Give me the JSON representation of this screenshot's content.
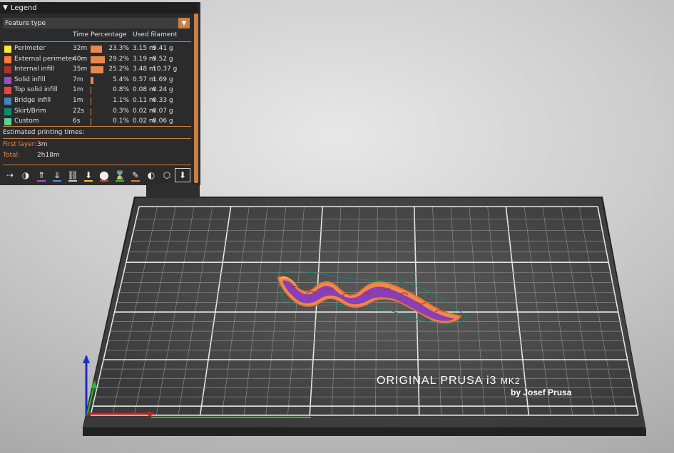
{
  "legend": {
    "title": "Legend",
    "view_type": "Feature type",
    "columns": {
      "time": "Time",
      "percentage": "Percentage",
      "used_filament": "Used filament"
    },
    "features": [
      {
        "name": "Perimeter",
        "time": "32m",
        "fraction": 0.233,
        "percent": "23.3%",
        "length": "3.15 m",
        "weight": "9.41 g",
        "color": "#ffe63a"
      },
      {
        "name": "External perimeter",
        "time": "40m",
        "fraction": 0.292,
        "percent": "29.2%",
        "length": "3.19 m",
        "weight": "9.52 g",
        "color": "#ff7d38"
      },
      {
        "name": "Internal infill",
        "time": "35m",
        "fraction": 0.252,
        "percent": "25.2%",
        "length": "3.48 m",
        "weight": "10.37 g",
        "color": "#b0302d"
      },
      {
        "name": "Solid infill",
        "time": "7m",
        "fraction": 0.054,
        "percent": "5.4%",
        "length": "0.57 m",
        "weight": "1.69 g",
        "color": "#9b4fc0"
      },
      {
        "name": "Top solid infill",
        "time": "1m",
        "fraction": 0.008,
        "percent": "0.8%",
        "length": "0.08 m",
        "weight": "0.24 g",
        "color": "#f0413c"
      },
      {
        "name": "Bridge infill",
        "time": "1m",
        "fraction": 0.011,
        "percent": "1.1%",
        "length": "0.11 m",
        "weight": "0.33 g",
        "color": "#4b80c0"
      },
      {
        "name": "Skirt/Brim",
        "time": "22s",
        "fraction": 0.003,
        "percent": "0.3%",
        "length": "0.02 m",
        "weight": "0.07 g",
        "color": "#0a8c73"
      },
      {
        "name": "Custom",
        "time": "6s",
        "fraction": 0.001,
        "percent": "0.1%",
        "length": "0.02 m",
        "weight": "0.06 g",
        "color": "#5ed19b"
      }
    ],
    "estimated_title": "Estimated printing times:",
    "first_layer_label": "First layer:",
    "first_layer_value": "3m",
    "total_label": "Total:",
    "total_value": "2h18m"
  },
  "toolbar": [
    {
      "icon": "travel-icon",
      "glyph": "⇢",
      "underline": ""
    },
    {
      "icon": "wipe-icon",
      "glyph": "◑",
      "underline": ""
    },
    {
      "icon": "retractions-icon",
      "glyph": "⇑",
      "underline": "#b14fc7"
    },
    {
      "icon": "deretractions-icon",
      "glyph": "⇓",
      "underline": "#4e8fdf"
    },
    {
      "icon": "seams-icon",
      "glyph": "⛓",
      "underline": "#cccccc"
    },
    {
      "icon": "tool-changes-icon",
      "glyph": "⬇",
      "underline": "#f3c13a"
    },
    {
      "icon": "color-changes-icon",
      "glyph": "⬤",
      "underline": "#c24a3c"
    },
    {
      "icon": "pause-icon",
      "glyph": "⌛",
      "underline": "#33bb55"
    },
    {
      "icon": "custom-gcode-icon",
      "glyph": "✎",
      "underline": "#e87a2e"
    },
    {
      "icon": "center-of-gravity-icon",
      "glyph": "◐",
      "underline": ""
    },
    {
      "icon": "shells-icon",
      "glyph": "⬡",
      "underline": ""
    },
    {
      "icon": "tool-marker-icon",
      "glyph": "⬇",
      "underline": ""
    }
  ],
  "bed": {
    "brand_line1": "ORIGINAL PRUSA i3",
    "brand_model": "MK2",
    "brand_line2": "by Josef Prusa"
  }
}
